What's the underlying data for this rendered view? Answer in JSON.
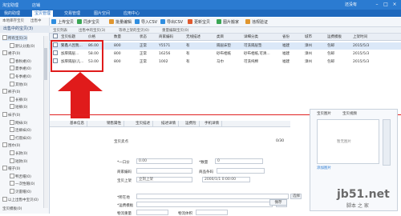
{
  "window": {
    "app_name": "淘宝助理",
    "app_name2": "店铺",
    "user_link": "还没有",
    "minimize": "–",
    "maximize": "□",
    "close": "×"
  },
  "menu": [
    "我的助理",
    "宝贝管理",
    "交易管理",
    "图片空间",
    "应用中心"
  ],
  "active_menu_index": 1,
  "toolbar": [
    {
      "icon": "upload-icon",
      "label": "上传宝贝",
      "color": "#2f8ee0"
    },
    {
      "icon": "sync-icon",
      "label": "同步宝贝",
      "color": "#3aa655"
    },
    {
      "icon": "batch-edit-icon",
      "label": "批量编辑",
      "color": "#e0962f"
    },
    {
      "icon": "import-icon",
      "label": "导入CSV",
      "color": "#2f8ee0"
    },
    {
      "icon": "export-icon",
      "label": "导出CSV",
      "color": "#2f8ee0"
    },
    {
      "icon": "update-icon",
      "label": "更新宝贝",
      "color": "#e05a2f"
    },
    {
      "icon": "image-search-icon",
      "label": "图片搬家",
      "color": "#3aa655"
    },
    {
      "icon": "verify-icon",
      "label": "违规验证",
      "color": "#e0962f"
    }
  ],
  "sidebar": {
    "tabs": [
      "本地库存宝贝",
      "出售中"
    ],
    "header": "出售中的宝贝(3)",
    "items": [
      {
        "label": "所有宝贝(3)",
        "selected": true
      },
      {
        "label": "默认分类(0)",
        "selected": false
      },
      {
        "label": "裙子(0)",
        "selected": false
      },
      {
        "label": "春秋裙(0)",
        "selected": false
      },
      {
        "label": "夏季裙(0)",
        "selected": false
      },
      {
        "label": "冬季裙(0)",
        "selected": false
      },
      {
        "label": "其他(0)",
        "selected": false
      },
      {
        "label": "裤子(0)",
        "selected": false
      },
      {
        "label": "长裤(0)",
        "selected": false
      },
      {
        "label": "短裤(0)",
        "selected": false
      },
      {
        "label": "袜子(0)",
        "selected": false
      },
      {
        "label": "网袜(0)",
        "selected": false
      },
      {
        "label": "连裤袜(0)",
        "selected": false
      },
      {
        "label": "打底袜(0)",
        "selected": false
      },
      {
        "label": "围巾(0)",
        "selected": false
      },
      {
        "label": "长款(0)",
        "selected": false
      },
      {
        "label": "短款(0)",
        "selected": false
      },
      {
        "label": "帽子(0)",
        "selected": false
      },
      {
        "label": "鸭舌帽(0)",
        "selected": false
      },
      {
        "label": "一次性帽(0)",
        "selected": false
      },
      {
        "label": "贝雷帽(0)",
        "selected": false
      },
      {
        "label": "以上出售中宝贝(0)",
        "selected": false
      }
    ],
    "footer": "宝贝模板(0)"
  },
  "list_tabs": [
    "宝贝列表",
    "出售中的宝贝(3)",
    "等待上架的宝贝(0)",
    "重量编辑宝贝(0)"
  ],
  "grid": {
    "columns": [
      "宝贝标题",
      "价格",
      "数量",
      "状态",
      "商家编码",
      "无线描述",
      "类目",
      "详细分类",
      "省份",
      "城市",
      "运费模板",
      "上架时间"
    ],
    "rows": [
      {
        "title": "繁鑫人因我...",
        "price": "86.00",
        "qty": "800",
        "status": "正常",
        "code": "Y5571",
        "wireless": "有",
        "category": "隔层床垫",
        "detail": "可洗隔层垫",
        "province": "福建",
        "city": "漳州",
        "freight": "包邮",
        "time": "2015/5/3"
      },
      {
        "title": "加厚隔层...",
        "price": "58.00",
        "qty": "800",
        "status": "正常",
        "code": "16256",
        "wireless": "有",
        "category": "砂布相纸",
        "detail": "砂布相纸,可清...",
        "province": "福建",
        "city": "漳州",
        "freight": "包邮",
        "time": "2015/5/3"
      },
      {
        "title": "加厚隔层(儿...",
        "price": "53.00",
        "qty": "800",
        "status": "正常",
        "code": "1002",
        "wireless": "有",
        "category": "马巾",
        "detail": "可洗纯棉",
        "province": "福建",
        "city": "漳州",
        "freight": "包邮",
        "time": "2015/5/3"
      }
    ]
  },
  "bottom_tabs": [
    "基本信息",
    "销售属性",
    "宝贝描述",
    "描述详情",
    "运费险",
    "手机详情"
  ],
  "form": {
    "title_label": "宝贝卖点",
    "counter": "0/30",
    "price_label": "*一口价",
    "price_value": "0.00",
    "qty_label": "*数量",
    "qty_value": "0",
    "code_label": "商家编码",
    "barcode_label": "商品条码",
    "time_label": "宝贝上架",
    "time_value": "立刻上架",
    "date_value": "2000/1/1 0:00:00",
    "location_label": "*所在地",
    "select_btn": "选择",
    "freight_label": "*运费模板",
    "edit_btn": "编辑",
    "weight_label": "物流重量",
    "volume_label": "物流体积",
    "save_btn": "保存"
  },
  "image_panel": {
    "tabs": [
      "宝贝图片",
      "宝贝视频"
    ],
    "no_image": "暂无图片",
    "add_label": "添加图片"
  },
  "watermark": {
    "site": "jb51.net",
    "cn": "脚本 之 家"
  }
}
